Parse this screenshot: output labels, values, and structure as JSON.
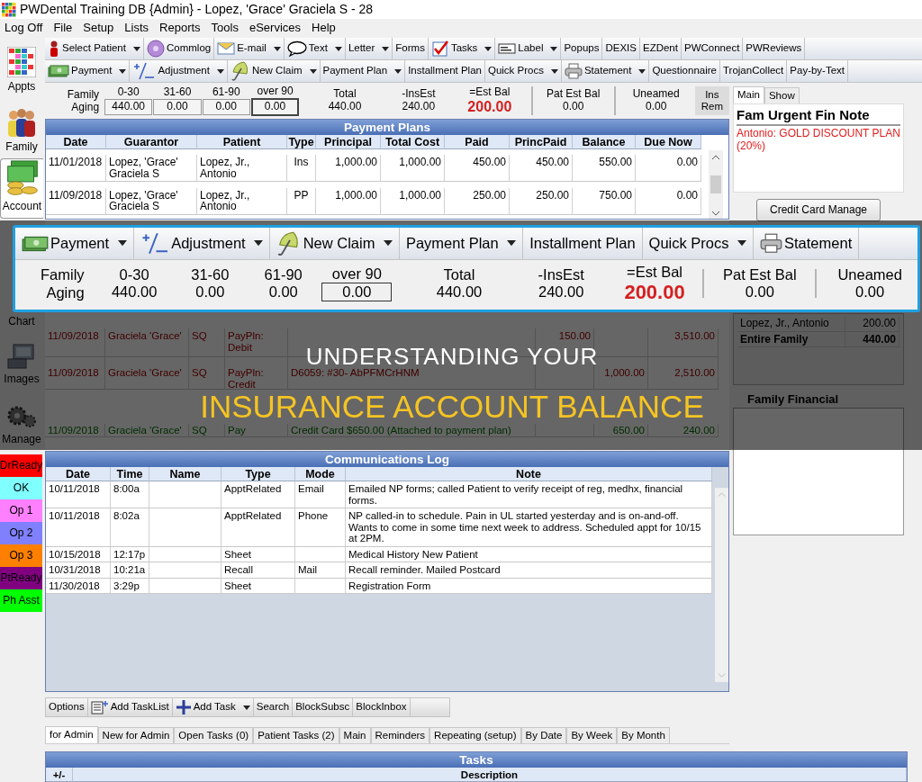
{
  "window": {
    "title": "PWDental Training DB {Admin} - Lopez, 'Grace' Graciela S - 28"
  },
  "menu": [
    "Log Off",
    "File",
    "Setup",
    "Lists",
    "Reports",
    "Tools",
    "eServices",
    "Help"
  ],
  "sidebar": {
    "modules": [
      {
        "label": "Appts",
        "selected": false
      },
      {
        "label": "Family",
        "selected": false
      },
      {
        "label": "Account",
        "selected": true
      },
      {
        "label": "Chart",
        "selected": false
      },
      {
        "label": "Images",
        "selected": false
      },
      {
        "label": "Manage",
        "selected": false
      }
    ],
    "statuses": [
      {
        "label": "DrReady",
        "color": "#ff0000"
      },
      {
        "label": "OK",
        "color": "#80ffff"
      },
      {
        "label": "Op 1",
        "color": "#ff80ff"
      },
      {
        "label": "Op 2",
        "color": "#8080ff"
      },
      {
        "label": "Op 3",
        "color": "#ff8000"
      },
      {
        "label": "PtReady",
        "color": "#800080"
      },
      {
        "label": "Ph Asst",
        "color": "#00ff00"
      }
    ]
  },
  "main_toolbar": [
    {
      "label": "Select Patient",
      "dropdown": true
    },
    {
      "label": "Commlog",
      "dropdown": false
    },
    {
      "label": "E-mail",
      "dropdown": true
    },
    {
      "label": "Text",
      "dropdown": true
    },
    {
      "label": "Letter",
      "dropdown": true
    },
    {
      "label": "Forms",
      "dropdown": false
    },
    {
      "label": "Tasks",
      "dropdown": true
    },
    {
      "label": "Label",
      "dropdown": true
    },
    {
      "label": "Popups",
      "dropdown": false
    },
    {
      "label": "DEXIS",
      "dropdown": false
    },
    {
      "label": "EZDent",
      "dropdown": false
    },
    {
      "label": "PWConnect",
      "dropdown": false
    },
    {
      "label": "PWReviews",
      "dropdown": false
    }
  ],
  "account_toolbar": [
    {
      "label": "Payment",
      "dropdown": true
    },
    {
      "label": "Adjustment",
      "dropdown": true
    },
    {
      "label": "New Claim",
      "dropdown": true
    },
    {
      "label": "Payment Plan",
      "dropdown": true
    },
    {
      "label": "Installment Plan",
      "dropdown": false
    },
    {
      "label": "Quick Procs",
      "dropdown": true
    },
    {
      "label": "Statement",
      "dropdown": true
    },
    {
      "label": "Questionnaire",
      "dropdown": false
    },
    {
      "label": "TrojanCollect",
      "dropdown": false
    },
    {
      "label": "Pay-by-Text",
      "dropdown": false
    }
  ],
  "aging": {
    "label": "Family Aging",
    "buckets": [
      {
        "label": "0-30",
        "value": "440.00",
        "selected": false
      },
      {
        "label": "31-60",
        "value": "0.00",
        "selected": false
      },
      {
        "label": "61-90",
        "value": "0.00",
        "selected": false
      },
      {
        "label": "over 90",
        "value": "0.00",
        "selected": true
      }
    ],
    "summary": [
      {
        "label": "Total",
        "value": "440.00",
        "kind": "plain"
      },
      {
        "label": "-InsEst",
        "value": "240.00",
        "kind": "plain"
      },
      {
        "label": "=Est Bal",
        "value": "200.00",
        "kind": "balance"
      },
      {
        "label": "Pat Est Bal",
        "value": "0.00",
        "kind": "separated"
      },
      {
        "label": "Uneamed",
        "value": "0.00",
        "kind": "separated"
      }
    ],
    "button": "Ins Rem"
  },
  "payment_plans": {
    "title": "Payment Plans",
    "columns": [
      "Date",
      "Guarantor",
      "Patient",
      "Type",
      "Principal",
      "Total Cost",
      "Paid",
      "PrincPaid",
      "Balance",
      "Due Now"
    ],
    "rows": [
      [
        "11/01/2018",
        "Lopez, 'Grace' Graciela S",
        "Lopez, Jr., Antonio",
        "Ins",
        "1,000.00",
        "1,000.00",
        "450.00",
        "450.00",
        "550.00",
        "0.00"
      ],
      [
        "11/09/2018",
        "Lopez, 'Grace' Graciela S",
        "Lopez, Jr., Antonio",
        "PP",
        "1,000.00",
        "1,000.00",
        "250.00",
        "250.00",
        "750.00",
        "0.00"
      ]
    ]
  },
  "ledger": {
    "rows": [
      {
        "cells": [
          "11/09/2018",
          "Graciela 'Grace'",
          "SQ",
          "PayPln: Debit",
          "",
          "150.00",
          "",
          "3,510.00"
        ],
        "kind": "plan"
      },
      {
        "cells": [
          "11/09/2018",
          "Graciela 'Grace'",
          "SQ",
          "PayPln: Credit",
          "D6059: #30- AbPFMCrHNM",
          "",
          "1,000.00",
          "2,510.00"
        ],
        "kind": "plan"
      },
      {
        "cells": [
          "11/09/2018",
          "Graciela 'Grace'",
          "SQ",
          "Pay",
          "Credit Card $650.00 (Attached to payment plan)",
          "",
          "650.00",
          "240.00"
        ],
        "kind": "payment"
      }
    ]
  },
  "right_panel": {
    "tabs": [
      {
        "label": "Main",
        "selected": true
      },
      {
        "label": "Show",
        "selected": false
      }
    ],
    "note_title": "Fam Urgent Fin Note",
    "note": "Antonio: GOLD DISCOUNT PLAN (20%)",
    "button": "Credit Card Manage",
    "balances": [
      {
        "name": "Lopez, Jr., Antonio",
        "amount": "200.00",
        "kind": "member"
      },
      {
        "name": "Entire Family",
        "amount": "440.00",
        "kind": "total"
      }
    ],
    "financial_title": "Family Financial"
  },
  "comm_log": {
    "title": "Communications Log",
    "columns": [
      "Date",
      "Time",
      "Name",
      "Type",
      "Mode",
      "Note"
    ],
    "rows": [
      [
        "10/11/2018",
        "8:00a",
        "",
        "ApptRelated",
        "Email",
        "Emailed NP forms; called Patient to verify receipt of reg, medhx, financial forms."
      ],
      [
        "10/11/2018",
        "8:02a",
        "",
        "ApptRelated",
        "Phone",
        "NP called-in to schedule. Pain in UL started yesterday and is on-and-off. Wants to come in some time next week to address.  Scheduled appt for 10/15 at 2PM."
      ],
      [
        "10/15/2018",
        "12:17p",
        "",
        "Sheet",
        "",
        "Medical History New Patient"
      ],
      [
        "10/31/2018",
        "10:21a",
        "",
        "Recall",
        "Mail",
        "Recall reminder.  Mailed Postcard"
      ],
      [
        "11/30/2018",
        "3:29p",
        "",
        "Sheet",
        "",
        "Registration Form"
      ]
    ]
  },
  "task_toolbar": [
    {
      "label": "Options",
      "dropdown": false
    },
    {
      "label": "Add TaskList",
      "dropdown": false
    },
    {
      "label": "Add Task",
      "dropdown": true
    },
    {
      "label": "Search",
      "dropdown": false
    },
    {
      "label": "BlockSubsc",
      "dropdown": false
    },
    {
      "label": "BlockInbox",
      "dropdown": false
    }
  ],
  "task_tabs": [
    {
      "label": "for Admin",
      "selected": true
    },
    {
      "label": "New for Admin",
      "selected": false
    },
    {
      "label": "Open Tasks (0)",
      "selected": false
    },
    {
      "label": "Patient Tasks (2)",
      "selected": false
    },
    {
      "label": "Main",
      "selected": false
    },
    {
      "label": "Reminders",
      "selected": false
    },
    {
      "label": "Repeating (setup)",
      "selected": false
    },
    {
      "label": "By Date",
      "selected": false
    },
    {
      "label": "By Week",
      "selected": false
    },
    {
      "label": "By Month",
      "selected": false
    }
  ],
  "tasks": {
    "title": "Tasks",
    "columns": [
      "+/-",
      "Description"
    ]
  },
  "inset": {
    "toolbar": [
      {
        "label": "Payment",
        "dropdown": true
      },
      {
        "label": "Adjustment",
        "dropdown": true
      },
      {
        "label": "New Claim",
        "dropdown": true
      },
      {
        "label": "Payment Plan",
        "dropdown": true
      },
      {
        "label": "Installment Plan",
        "dropdown": false
      },
      {
        "label": "Quick Procs",
        "dropdown": true
      },
      {
        "label": "Statement",
        "dropdown": false
      }
    ],
    "aging": {
      "label": "Family Aging",
      "buckets": [
        {
          "label": "0-30",
          "value": "440.00",
          "selected": false
        },
        {
          "label": "31-60",
          "value": "0.00",
          "selected": false
        },
        {
          "label": "61-90",
          "value": "0.00",
          "selected": false
        },
        {
          "label": "over 90",
          "value": "0.00",
          "selected": true
        }
      ],
      "summary": [
        {
          "label": "Total",
          "value": "440.00",
          "kind": "plain"
        },
        {
          "label": "-InsEst",
          "value": "240.00",
          "kind": "plain"
        },
        {
          "label": "=Est Bal",
          "value": "200.00",
          "kind": "balance"
        },
        {
          "label": "Pat Est Bal",
          "value": "0.00",
          "kind": "separated"
        },
        {
          "label": "Uneamed",
          "value": "0.00",
          "kind": "separated"
        }
      ]
    }
  },
  "headline": [
    {
      "text": "UNDERSTANDING YOUR",
      "color": "#ffffff"
    },
    {
      "text": "INSURANCE ACCOUNT BALANCE",
      "color": "#f5c423"
    }
  ]
}
